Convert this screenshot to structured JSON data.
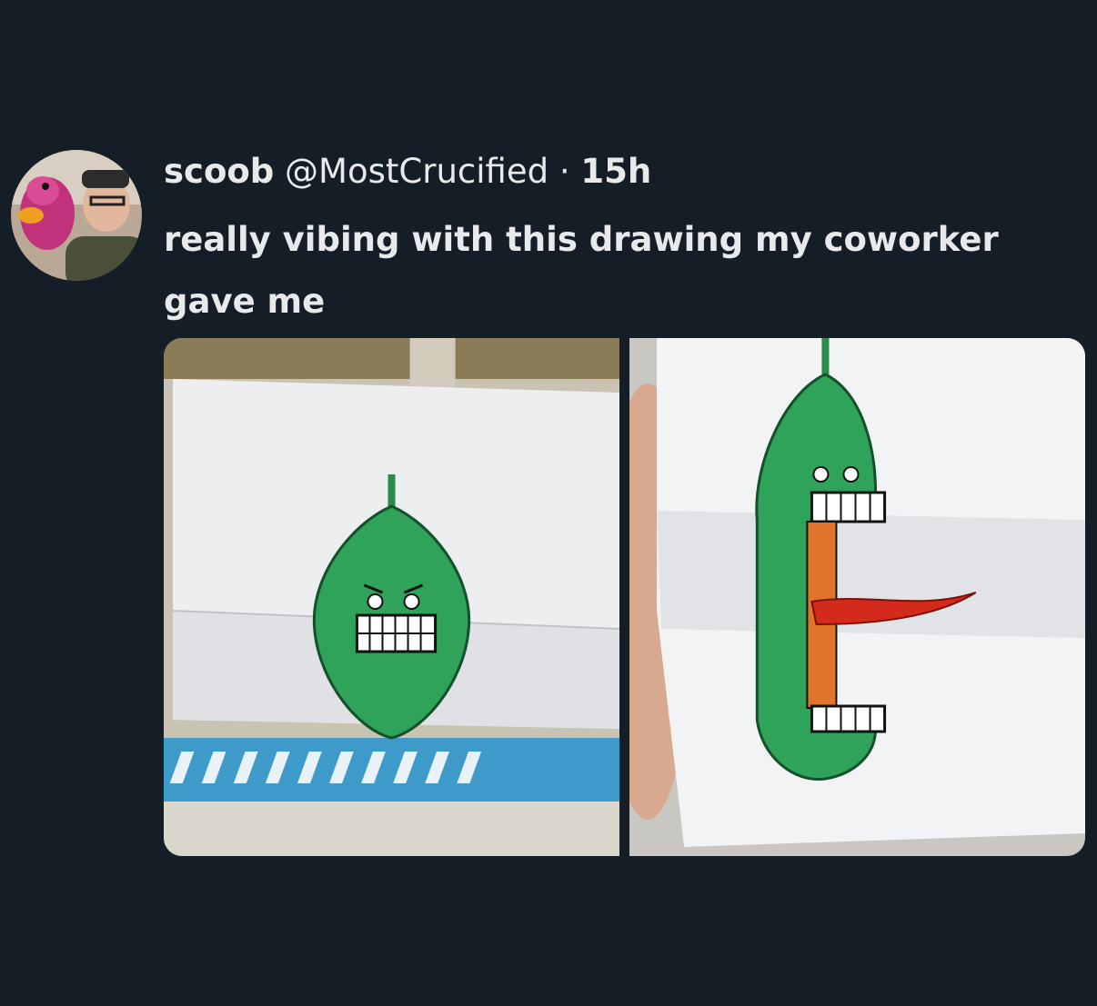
{
  "tweet": {
    "display_name": "scoob",
    "handle": "@MostCrucified",
    "separator": "·",
    "time": "15h",
    "text_line1": "really vibing with this drawing my coworker",
    "text_line2": "gave me"
  },
  "media": {
    "photos": [
      {
        "icon": "closed-pickle-drawing-photo"
      },
      {
        "icon": "open-mouth-pickle-drawing-photo"
      }
    ]
  },
  "colors": {
    "background": "#151d27",
    "text": "#e7e9ea",
    "pickle_green": "#2fa35a",
    "tongue_red": "#d42a1c",
    "throat_orange": "#e0742a"
  }
}
